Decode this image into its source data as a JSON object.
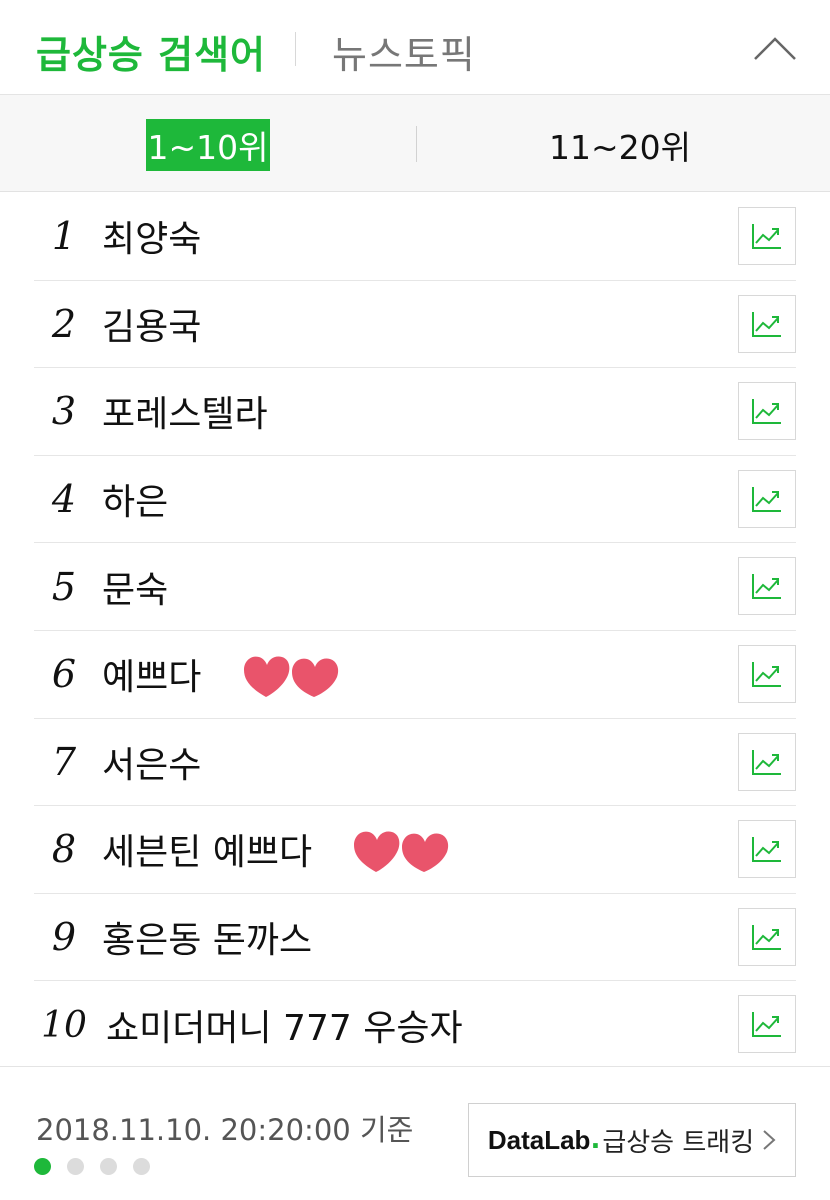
{
  "header": {
    "tab_active": "급상승 검색어",
    "tab_inactive": "뉴스토픽",
    "collapse_icon": "chevron-up-icon"
  },
  "range": {
    "active": "1~10위",
    "inactive": "11~20위"
  },
  "accent_color": "#1eb83a",
  "heart_color": "#e9546b",
  "rankings": [
    {
      "rank": "1",
      "keyword": "최양숙",
      "hearts": false
    },
    {
      "rank": "2",
      "keyword": "김용국",
      "hearts": false
    },
    {
      "rank": "3",
      "keyword": "포레스텔라",
      "hearts": false
    },
    {
      "rank": "4",
      "keyword": "하은",
      "hearts": false
    },
    {
      "rank": "5",
      "keyword": "문숙",
      "hearts": false
    },
    {
      "rank": "6",
      "keyword": "예쁘다",
      "hearts": true
    },
    {
      "rank": "7",
      "keyword": "서은수",
      "hearts": false
    },
    {
      "rank": "8",
      "keyword": "세븐틴 예쁘다",
      "hearts": true
    },
    {
      "rank": "9",
      "keyword": "홍은동 돈까스",
      "hearts": false
    },
    {
      "rank": "10",
      "keyword": "쇼미더머니 777 우승자",
      "hearts": false
    }
  ],
  "footer": {
    "basis_time": "2018.11.10. 20:20:00 기준",
    "page_dots": 4,
    "active_dot": 1,
    "datalab_brand": "DataLab",
    "datalab_dot": ".",
    "datalab_label": "급상승 트래킹",
    "datalab_icon": "chevron-right-icon"
  }
}
